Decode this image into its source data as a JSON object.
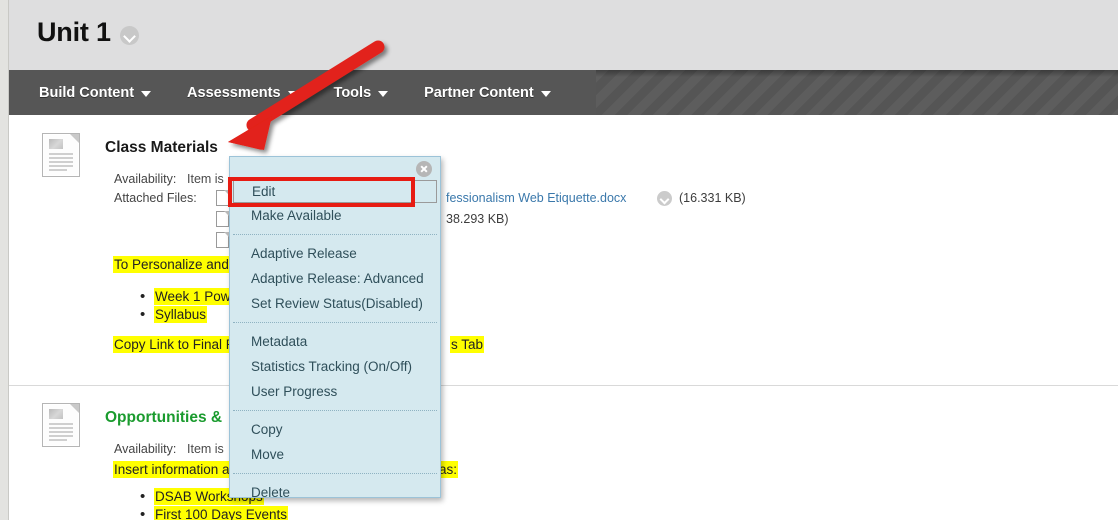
{
  "header": {
    "title": "Unit 1",
    "chevron_icon": "chevron-down-circle-icon"
  },
  "nav": {
    "items": [
      {
        "label": "Build Content",
        "caret": "chevron-down-icon"
      },
      {
        "label": "Assessments",
        "caret": "chevron-down-icon"
      },
      {
        "label": "Tools",
        "caret": "chevron-down-icon"
      },
      {
        "label": "Partner Content",
        "caret": "chevron-down-icon"
      }
    ]
  },
  "content": {
    "items": [
      {
        "title": "Class Materials",
        "title_color": "#1a1a1a",
        "icon": "document-icon",
        "availability_label": "Availability:",
        "availability_value": "Item is",
        "attached_files_label": "Attached Files:",
        "files": [
          {
            "name": "fessionalism Web Etiquette.docx",
            "size": "(16.331 KB)",
            "chevron": "chevron-down-circle-icon"
          },
          {
            "name": "",
            "size": "38.293 KB)",
            "chevron": ""
          },
          {
            "name": "",
            "size": "",
            "chevron": ""
          }
        ],
        "body_lines": [
          "To Personalize and",
          "Copy Link to Final R",
          "s Tab"
        ],
        "bullets": [
          "Week 1 Pow",
          "Syllabus"
        ]
      },
      {
        "title": "Opportunities &",
        "title_color": "#1a9b2e",
        "icon": "document-icon",
        "availability_label": "Availability:",
        "availability_value": "Item is",
        "body_lines": [
          "Insert information ab",
          "ch as:"
        ],
        "bullets": [
          "DSAB Workshops",
          "First 100 Days Events"
        ]
      }
    ]
  },
  "context_menu": {
    "close_icon": "close-circle-icon",
    "groups": [
      {
        "items": [
          {
            "label": "Edit",
            "selected": true
          },
          {
            "label": "Make Available",
            "selected": false
          }
        ]
      },
      {
        "items": [
          {
            "label": "Adaptive Release",
            "selected": false
          },
          {
            "label": "Adaptive Release: Advanced",
            "selected": false
          },
          {
            "label": "Set Review Status(Disabled)",
            "selected": false
          }
        ]
      },
      {
        "items": [
          {
            "label": "Metadata",
            "selected": false
          },
          {
            "label": "Statistics Tracking (On/Off)",
            "selected": false
          },
          {
            "label": "User Progress",
            "selected": false
          }
        ]
      },
      {
        "items": [
          {
            "label": "Copy",
            "selected": false
          },
          {
            "label": "Move",
            "selected": false
          }
        ]
      },
      {
        "items": [
          {
            "label": "Delete",
            "selected": false
          }
        ]
      }
    ]
  },
  "annotations": {
    "arrow_color": "#e2231a",
    "highlight_box_color": "#e71b12"
  },
  "colors": {
    "header_bg": "#dededf",
    "nav_bg": "#565656",
    "menu_bg": "#d5e9ef",
    "menu_border": "#9cc3d8",
    "highlight_yellow": "#ffff00",
    "link_blue": "#3a78ab",
    "green_title": "#1a9b2e"
  }
}
